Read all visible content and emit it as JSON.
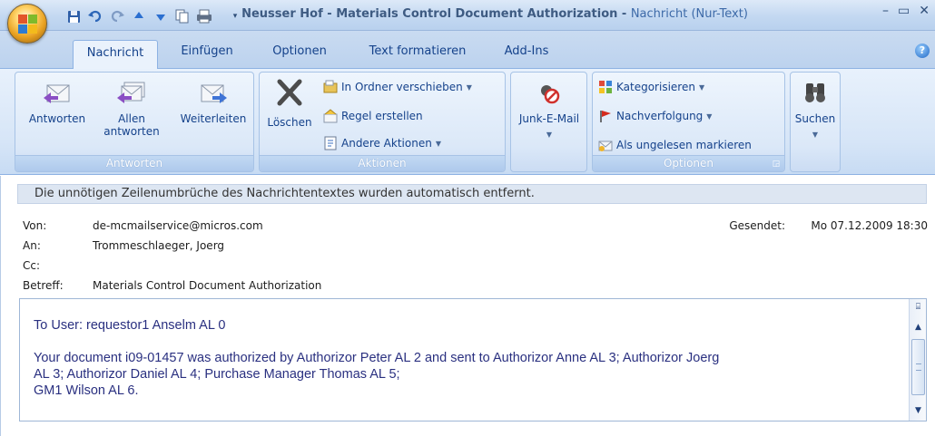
{
  "window": {
    "title": "Neusser Hof - Materials Control Document Authorization - ",
    "subtitle": "Nachricht (Nur-Text)",
    "minimize_icon": "minimize-icon",
    "maximize_icon": "maximize-icon",
    "close_icon": "close-icon"
  },
  "quick_access": [
    "save-icon",
    "undo-icon",
    "redo-icon",
    "previous-item-icon",
    "next-item-icon",
    "copy-icon",
    "print-icon"
  ],
  "tabs": [
    {
      "label": "Nachricht",
      "active": true
    },
    {
      "label": "Einfügen",
      "active": false
    },
    {
      "label": "Optionen",
      "active": false
    },
    {
      "label": "Text formatieren",
      "active": false
    },
    {
      "label": "Add-Ins",
      "active": false
    }
  ],
  "ribbon": {
    "antworten": {
      "group_label": "Antworten",
      "reply": "Antworten",
      "reply_all_line1": "Allen",
      "reply_all_line2": "antworten",
      "forward": "Weiterleiten"
    },
    "aktionen": {
      "group_label": "Aktionen",
      "delete": "Löschen",
      "move_to_folder": "In Ordner verschieben",
      "create_rule": "Regel erstellen",
      "other_actions": "Andere Aktionen"
    },
    "junk": {
      "label": "Junk-E-Mail"
    },
    "optionen": {
      "group_label": "Optionen",
      "categorize": "Kategorisieren",
      "follow_up": "Nachverfolgung",
      "mark_unread": "Als ungelesen markieren"
    },
    "suchen": {
      "label": "Suchen"
    }
  },
  "message": {
    "infobar": "Die unnötigen Zeilenumbrüche des Nachrichtentextes wurden automatisch entfernt.",
    "from_label": "Von:",
    "from_value": "de-mcmailservice@micros.com",
    "to_label": "An:",
    "to_value": "Trommeschlaeger, Joerg",
    "cc_label": "Cc:",
    "cc_value": "",
    "subject_label": "Betreff:",
    "subject_value": "Materials Control Document Authorization",
    "sent_label": "Gesendet:",
    "sent_value": "Mo 07.12.2009 18:30"
  },
  "body": {
    "line1": "To User: requestor1 Anselm AL 0",
    "line2a": "Your document i09-01457 was authorized by Authorizor Peter AL 2 and sent to Authorizor Anne AL 3; Authorizor Joerg",
    "line2b": "AL 3; Authorizor Daniel AL 4; Purchase Manager Thomas AL 5;",
    "line3": "GM1 Wilson AL 6."
  },
  "colors": {
    "accent": "#15428b",
    "ribbon_bg": "#d6e5f7",
    "body_text": "#2a3080"
  }
}
